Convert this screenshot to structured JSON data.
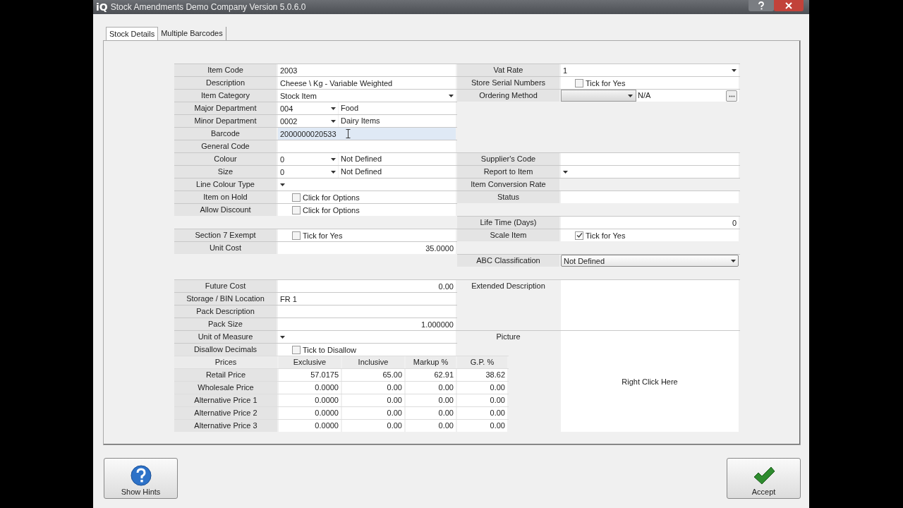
{
  "window": {
    "logo": "iQ",
    "title": "Stock Amendments Demo Company Version 5.0.6.0"
  },
  "tabs": [
    {
      "label": "Stock Details",
      "selected": true
    },
    {
      "label": "Multiple Barcodes",
      "selected": false
    }
  ],
  "left_sections": [
    [
      {
        "label": "Item Code",
        "kind": "text",
        "value": "2003"
      },
      {
        "label": "Description",
        "kind": "text",
        "value": "Cheese \\ Kg - Variable Weighted"
      },
      {
        "label": "Item Category",
        "kind": "combo",
        "value": "Stock Item"
      },
      {
        "label": "Major Department",
        "kind": "split",
        "code": "004",
        "name": "Food"
      },
      {
        "label": "Minor Department",
        "kind": "split",
        "code": "0002",
        "name": "Dairy Items"
      },
      {
        "label": "Barcode",
        "kind": "text",
        "value": "2000000020533",
        "focused": true
      },
      {
        "label": "General Code",
        "kind": "text"
      },
      {
        "label": "Colour",
        "kind": "split",
        "code": "0",
        "name": "Not Defined"
      },
      {
        "label": "Size",
        "kind": "split",
        "code": "0",
        "name": "Not Defined"
      },
      {
        "label": "Line Colour Type",
        "kind": "combo"
      },
      {
        "label": "Item on Hold",
        "kind": "checkbox",
        "checked": false,
        "caption": "Click for Options"
      },
      {
        "label": "Allow Discount",
        "kind": "checkbox",
        "checked": false,
        "caption": "Click for Options"
      }
    ],
    [
      {
        "label": "Section 7 Exempt",
        "kind": "checkbox",
        "checked": false,
        "caption": "Tick for Yes"
      },
      {
        "label": "Unit Cost",
        "kind": "number",
        "value": "35.0000"
      }
    ],
    [
      {
        "label": "Future Cost",
        "kind": "number",
        "value": "0.00"
      },
      {
        "label": "Storage / BIN Location",
        "kind": "text",
        "value": "FR 1"
      },
      {
        "label": "Pack Description",
        "kind": "text"
      },
      {
        "label": "Pack Size",
        "kind": "number",
        "value": "1.000000"
      },
      {
        "label": "Unit of Measure",
        "kind": "combo"
      },
      {
        "label": "Disallow Decimals",
        "kind": "checkbox",
        "checked": false,
        "caption": "Tick to Disallow"
      }
    ]
  ],
  "prices": {
    "columns": [
      "Prices",
      "Exclusive",
      "Inclusive",
      "Markup %",
      "G.P. %"
    ],
    "rows": [
      [
        "Retail Price",
        "57.0175",
        "65.00",
        "62.91",
        "38.62"
      ],
      [
        "Wholesale Price",
        "0.0000",
        "0.00",
        "0.00",
        "0.00"
      ],
      [
        "Alternative Price 1",
        "0.0000",
        "0.00",
        "0.00",
        "0.00"
      ],
      [
        "Alternative Price 2",
        "0.0000",
        "0.00",
        "0.00",
        "0.00"
      ],
      [
        "Alternative Price 3",
        "0.0000",
        "0.00",
        "0.00",
        "0.00"
      ]
    ]
  },
  "right_sections": [
    [
      {
        "label": "Vat Rate",
        "kind": "combo",
        "value": "1"
      },
      {
        "label": "Store Serial Numbers",
        "kind": "checkbox",
        "checked": false,
        "caption": "Tick for Yes"
      },
      {
        "label": "Ordering Method",
        "kind": "picker",
        "value": "N/A"
      }
    ],
    [
      {
        "label": "Supplier's Code",
        "kind": "text"
      },
      {
        "label": "Report to Item",
        "kind": "combo"
      },
      {
        "label": "Item Conversion Rate",
        "kind": "readonly"
      },
      {
        "label": "Status",
        "kind": "text"
      }
    ],
    [
      {
        "label": "Life Time (Days)",
        "kind": "number",
        "value": "0"
      },
      {
        "label": "Scale Item",
        "kind": "checkbox",
        "checked": true,
        "caption": "Tick for Yes"
      }
    ],
    [
      {
        "label": "ABC Classification",
        "kind": "combo",
        "value": "Not Defined"
      }
    ],
    [
      {
        "label": "Extended Description",
        "kind": "memo"
      },
      {
        "label": "Picture",
        "kind": "picture",
        "hint": "Right Click Here"
      }
    ]
  ],
  "buttons": [
    {
      "label": "Show Hints",
      "kind": "help"
    },
    {
      "label": "Accept",
      "kind": "accept"
    }
  ]
}
